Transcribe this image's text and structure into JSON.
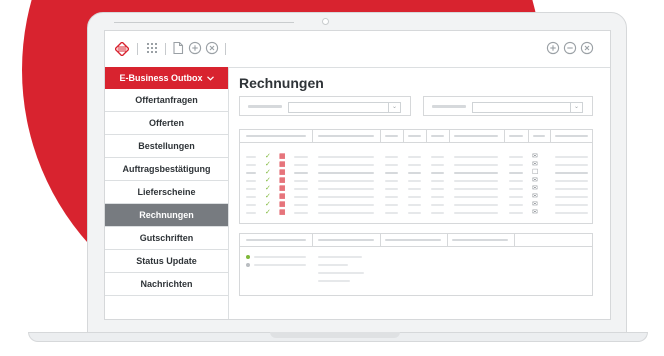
{
  "colors": {
    "accent": "#d8232f",
    "active_item": "#777b80",
    "check_icon": "#7fb83a"
  },
  "toolbar": {
    "left_icons": [
      "logo-icon",
      "grid-icon",
      "document-icon",
      "add-circle-icon",
      "close-circle-icon"
    ],
    "right_icons": [
      "add-circle-icon",
      "remove-circle-icon",
      "close-circle-icon"
    ]
  },
  "sidebar": {
    "header": "E-Business Outbox",
    "header_icon": "chevron-down-icon",
    "items": [
      {
        "label": "Offertanfragen",
        "active": false
      },
      {
        "label": "Offerten",
        "active": false
      },
      {
        "label": "Bestellungen",
        "active": false
      },
      {
        "label": "Auftragsbestätigung",
        "active": false
      },
      {
        "label": "Lieferscheine",
        "active": false
      },
      {
        "label": "Rechnungen",
        "active": true
      },
      {
        "label": "Gutschriften",
        "active": false
      },
      {
        "label": "Status Update",
        "active": false
      },
      {
        "label": "Nachrichten",
        "active": false
      }
    ]
  },
  "main": {
    "title": "Rechnungen"
  }
}
